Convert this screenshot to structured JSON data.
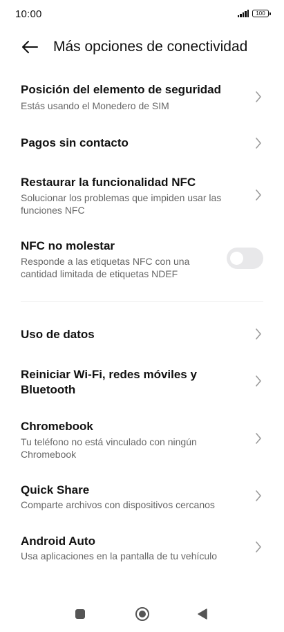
{
  "status": {
    "time": "10:00",
    "battery": "100"
  },
  "header": {
    "title": "Más opciones de conectividad"
  },
  "items": [
    {
      "title": "Posición del elemento de seguridad",
      "subtitle": "Estás usando el Monedero de SIM"
    },
    {
      "title": "Pagos sin contacto",
      "subtitle": ""
    },
    {
      "title": "Restaurar la funcionalidad NFC",
      "subtitle": "Solucionar los problemas que impiden usar las funciones NFC"
    },
    {
      "title": "NFC no molestar",
      "subtitle": "Responde a las etiquetas NFC con una cantidad limitada de etiquetas NDEF",
      "toggle_on": false
    },
    {
      "title": "Uso de datos",
      "subtitle": ""
    },
    {
      "title": "Reiniciar Wi-Fi, redes móviles y Bluetooth",
      "subtitle": ""
    },
    {
      "title": "Chromebook",
      "subtitle": "Tu teléfono no está vinculado con ningún Chromebook"
    },
    {
      "title": "Quick Share",
      "subtitle": "Comparte archivos con dispositivos cercanos"
    },
    {
      "title": "Android Auto",
      "subtitle": "Usa aplicaciones en la pantalla de tu vehículo"
    }
  ],
  "icons": {
    "back": "arrow-left-icon",
    "chevron": "chevron-right-icon",
    "nav_recents": "square-icon",
    "nav_home": "circle-icon",
    "nav_back": "triangle-left-icon"
  },
  "colors": {
    "background": "#ffffff",
    "title_text": "#111111",
    "subtitle_text": "#666666",
    "toggle_off": "#e8e8ea"
  }
}
